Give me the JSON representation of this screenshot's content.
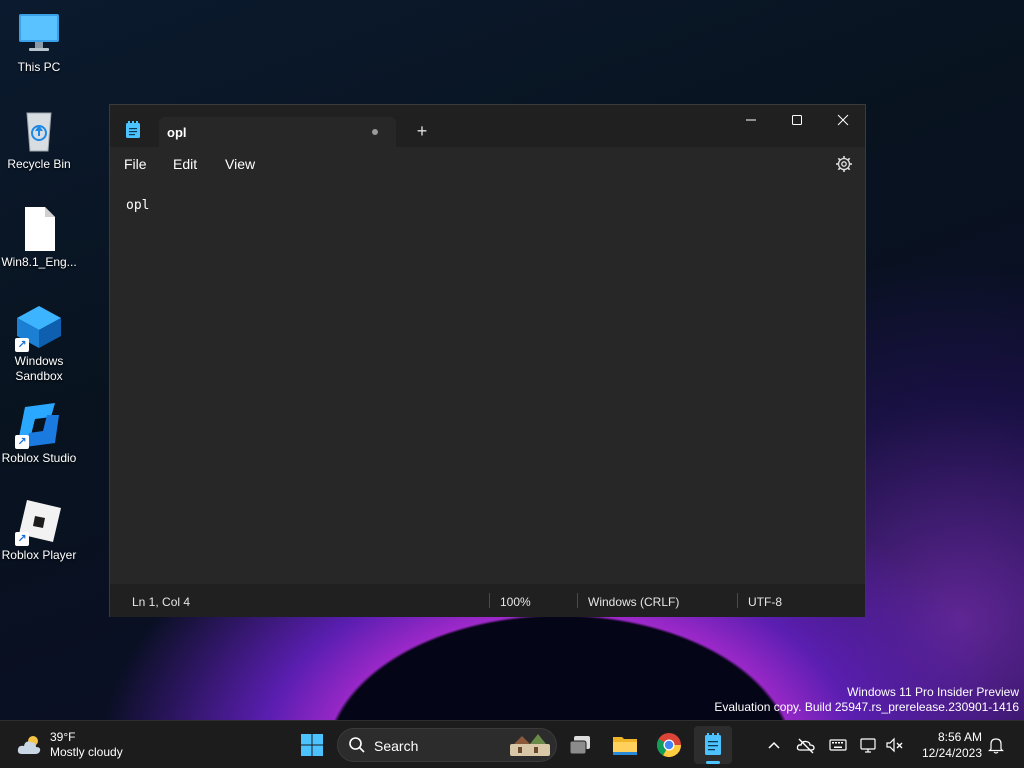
{
  "desktop": {
    "icons": [
      {
        "label": "This PC",
        "icon": "monitor-icon"
      },
      {
        "label": "Recycle Bin",
        "icon": "recycle-bin-icon"
      },
      {
        "label": "Win8.1_Eng...",
        "icon": "file-icon"
      },
      {
        "label_line1": "Windows",
        "label_line2": "Sandbox",
        "icon": "windows-sandbox-icon"
      },
      {
        "label": "Roblox Studio",
        "icon": "roblox-studio-icon"
      },
      {
        "label": "Roblox Player",
        "icon": "roblox-player-icon"
      }
    ],
    "watermark": {
      "line1": "Windows 11 Pro Insider Preview",
      "line2": "Evaluation copy. Build 25947.rs_prerelease.230901-1416"
    }
  },
  "notepad": {
    "tab_title": "opl",
    "unsaved_indicator": "dot-icon",
    "new_tab_label": "+",
    "menu": {
      "file": "File",
      "edit": "Edit",
      "view": "View"
    },
    "content": "opl",
    "status": {
      "position": "Ln 1, Col 4",
      "zoom": "100%",
      "line_ending": "Windows (CRLF)",
      "encoding": "UTF-8"
    }
  },
  "taskbar": {
    "weather": {
      "temp": "39°F",
      "desc": "Mostly cloudy"
    },
    "search_placeholder": "Search",
    "clock": {
      "time": "8:56 AM",
      "date": "12/24/2023"
    },
    "pinned": [
      "windows-start-icon",
      "task-view-icon",
      "file-explorer-icon",
      "chrome-icon",
      "notepad-icon"
    ],
    "tray": [
      "chevron-up-icon",
      "onedrive-offline-icon",
      "keyboard-icon",
      "display-network-icon",
      "volume-muted-icon",
      "bell-icon"
    ]
  },
  "colors": {
    "window_bg": "#272727",
    "titlebar_bg": "#202020",
    "taskbar_bg": "#1c1c1c",
    "accent": "#4cc2ff"
  }
}
